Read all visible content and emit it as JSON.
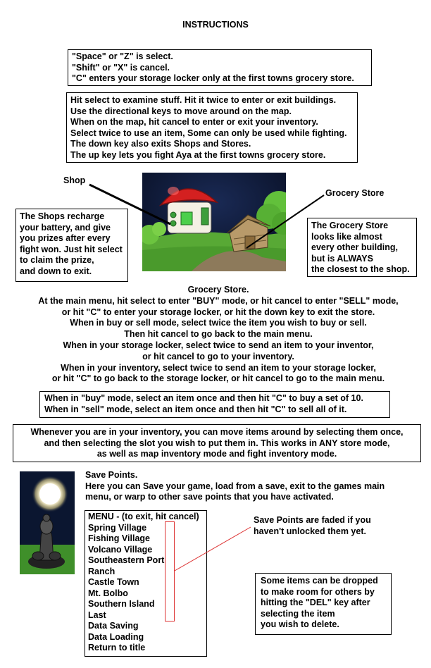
{
  "title": "INSTRUCTIONS",
  "controls": [
    "\"Space\" or \"Z\" is select.",
    "\"Shift\" or \"X\" is cancel.",
    "\"C\" enters your storage locker only at the first towns grocery store."
  ],
  "basics": [
    "Hit select to examine stuff. Hit it twice to enter or exit buildings.",
    "Use the directional keys to move around on the map.",
    "When on the map, hit cancel to enter or exit your inventory.",
    "Select twice to use an item, Some can only be used while fighting.",
    "The down key also exits Shops and Stores.",
    "The up key lets you fight Aya at the first towns grocery store."
  ],
  "labels": {
    "shop": "Shop",
    "grocery_store": "Grocery Store"
  },
  "shops_note": [
    "The Shops recharge",
    "your battery, and give",
    "you prizes after every",
    "fight won. Just hit select",
    "to claim the prize,",
    "and down to exit."
  ],
  "grocery_note": [
    "The Grocery Store",
    "looks like almost",
    "every other building,",
    "but is ALWAYS",
    "the closest to the shop."
  ],
  "grocery_section": {
    "heading": "Grocery Store.",
    "lines": [
      "At the main menu, hit select to enter \"BUY\" mode, or hit cancel to enter \"SELL\" mode,",
      "or hit \"C\" to enter your storage locker, or hit the down key to exit the store.",
      "When in buy or sell mode, select twice the item you wish to buy or sell.",
      "Then hit cancel to go back to the main menu.",
      "When in your storage locker, select twice to send an item to your inventor,",
      "or hit cancel to go to your inventory.",
      "When in your inventory, select twice to send an item to your storage locker,",
      "or hit \"C\" to go back to the storage locker, or hit cancel to go to the main menu."
    ]
  },
  "mode_tips": [
    "When in \"buy\" mode, select an item once and then hit \"C\" to buy a set of 10.",
    "When in \"sell\" mode, select an item once and then hit \"C\" to sell all of it."
  ],
  "inventory_tip": [
    "Whenever you are in your inventory, you can move items around by selecting them once,",
    "and then selecting the slot you wish to put them in. This works in ANY store mode,",
    "as well as map inventory mode and fight inventory mode."
  ],
  "save_points": {
    "heading": "Save Points.",
    "lines": [
      "Here you can Save your game, load from a save, exit to the games main",
      "menu, or warp to other save points that you have activated."
    ]
  },
  "menu": [
    "MENU - (to exit, hit cancel)",
    "Spring Village",
    "Fishing Village",
    "Volcano Village",
    "Southeastern Port",
    "Ranch",
    "Castle Town",
    "Mt. Bolbo",
    "Southern Island",
    "Last",
    "Data Saving",
    "Data Loading",
    "Return to title"
  ],
  "faded_note": [
    "Save Points are faded if you",
    "haven't unlocked them yet."
  ],
  "drop_note": [
    "Some items can be dropped",
    "to make room for others by",
    "hitting the \"DEL\" key after",
    "selecting the item",
    "you wish to delete."
  ],
  "colors": {
    "pointer": "#000000",
    "highlight": "#dd3333",
    "roof_red": "#d42020",
    "grass_green": "#5fb63a",
    "night_sky": "#0b1630"
  }
}
